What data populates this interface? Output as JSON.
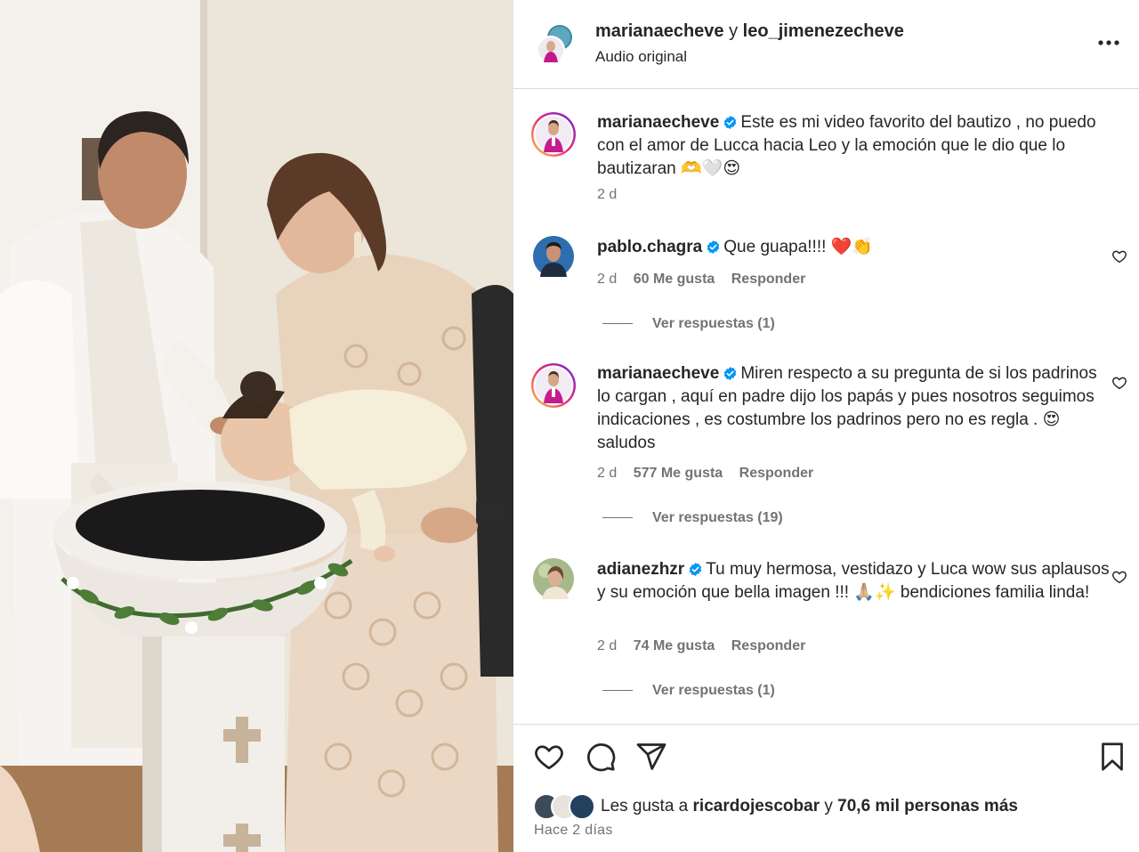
{
  "colors": {
    "accent_verified": "#0095f6",
    "text": "#262626",
    "muted": "#737373",
    "divider": "#dbdbdb",
    "heart_red": "#e0245e"
  },
  "header": {
    "user1": "marianaecheve",
    "joiner": "y",
    "user2": "leo_jimenezecheve",
    "subtitle": "Audio original",
    "more_icon": "more-horizontal-icon"
  },
  "caption": {
    "user": "marianaecheve",
    "text": "Este es mi video favorito del bautizo , no puedo con el amor de Lucca hacia Leo y la emoción que le dio que lo bautizaran 🫶🤍😍",
    "time": "2 d"
  },
  "comments": [
    {
      "user": "pablo.chagra",
      "text": "Que guapa!!!! ❤️👏",
      "time": "2 d",
      "likes": "60 Me gusta",
      "reply": "Responder",
      "view_replies": "Ver respuestas (1)"
    },
    {
      "user": "marianaecheve",
      "text": "Miren respecto a su pregunta de si los padrinos lo cargan , aquí en padre dijo los papás y pues nosotros seguimos indicaciones , es costumbre los padrinos pero no es regla . 😍 saludos",
      "time": "2 d",
      "likes": "577 Me gusta",
      "reply": "Responder",
      "view_replies": "Ver respuestas (19)"
    },
    {
      "user": "adianezhzr",
      "text": "Tu muy hermosa, vestidazo y Luca wow sus aplausos y su emoción que bella imagen !!! 🙏🏼✨ bendiciones familia linda!",
      "time": "2 d",
      "likes": "74 Me gusta",
      "reply": "Responder",
      "view_replies": "Ver respuestas (1)"
    }
  ],
  "footer": {
    "likes_prefix": "Les gusta a",
    "likes_user": "ricardojescobar",
    "likes_joiner": "y",
    "likes_rest": "70,6 mil personas más",
    "posted_ago": "Hace 2 días"
  }
}
